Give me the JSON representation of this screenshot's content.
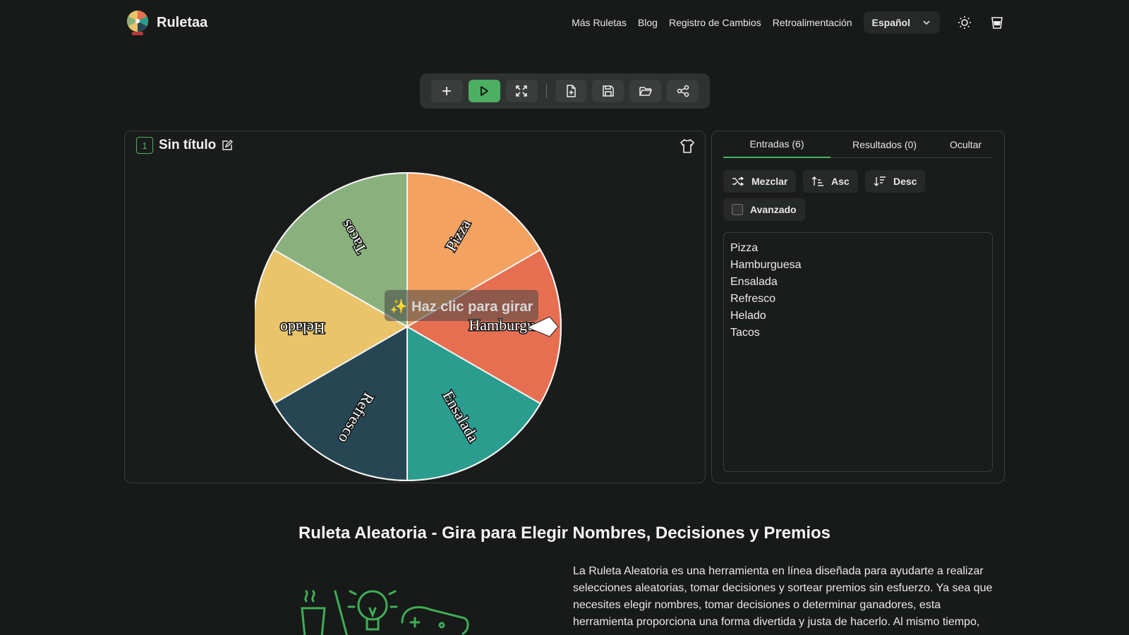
{
  "header": {
    "brand": "Ruletaa",
    "nav": [
      "Más Ruletas",
      "Blog",
      "Registro de Cambios",
      "Retroalimentación"
    ],
    "language": "Español"
  },
  "toolbar": {
    "buttons": [
      "add-icon",
      "play-icon",
      "fullscreen-icon",
      "new-file-icon",
      "save-icon",
      "open-folder-icon",
      "share-icon"
    ]
  },
  "wheel": {
    "number": "1",
    "title": "Sin título",
    "cta": "✨ Haz clic para girar",
    "segments": [
      {
        "label": "Pizza",
        "color": "#f4a261"
      },
      {
        "label": "Hamburguesa",
        "color": "#e76f51"
      },
      {
        "label": "Ensalada",
        "color": "#2a9d8f"
      },
      {
        "label": "Refresco",
        "color": "#264653"
      },
      {
        "label": "Helado",
        "color": "#e9c46a"
      },
      {
        "label": "Tacos",
        "color": "#8ab17d"
      }
    ]
  },
  "side": {
    "tabs": [
      "Entradas (6)",
      "Resultados (0)",
      "Ocultar"
    ],
    "actions": {
      "shuffle": "Mezclar",
      "asc": "Asc",
      "desc": "Desc",
      "advanced": "Avanzado"
    },
    "entries": [
      "Pizza",
      "Hamburguesa",
      "Ensalada",
      "Refresco",
      "Helado",
      "Tacos"
    ]
  },
  "article": {
    "title": "Ruleta Aleatoria - Gira para Elegir Nombres, Decisiones y Premios",
    "paragraph": "La Ruleta Aleatoria es una herramienta en línea diseñada para ayudarte a realizar selecciones aleatorias, tomar decisiones y sortear premios sin esfuerzo. Ya sea que necesites elegir nombres, tomar decisiones o determinar ganadores, esta herramienta proporciona una forma divertida y justa de hacerlo. Al mismo tiempo,"
  },
  "colors": {
    "accent": "#4caf62"
  }
}
